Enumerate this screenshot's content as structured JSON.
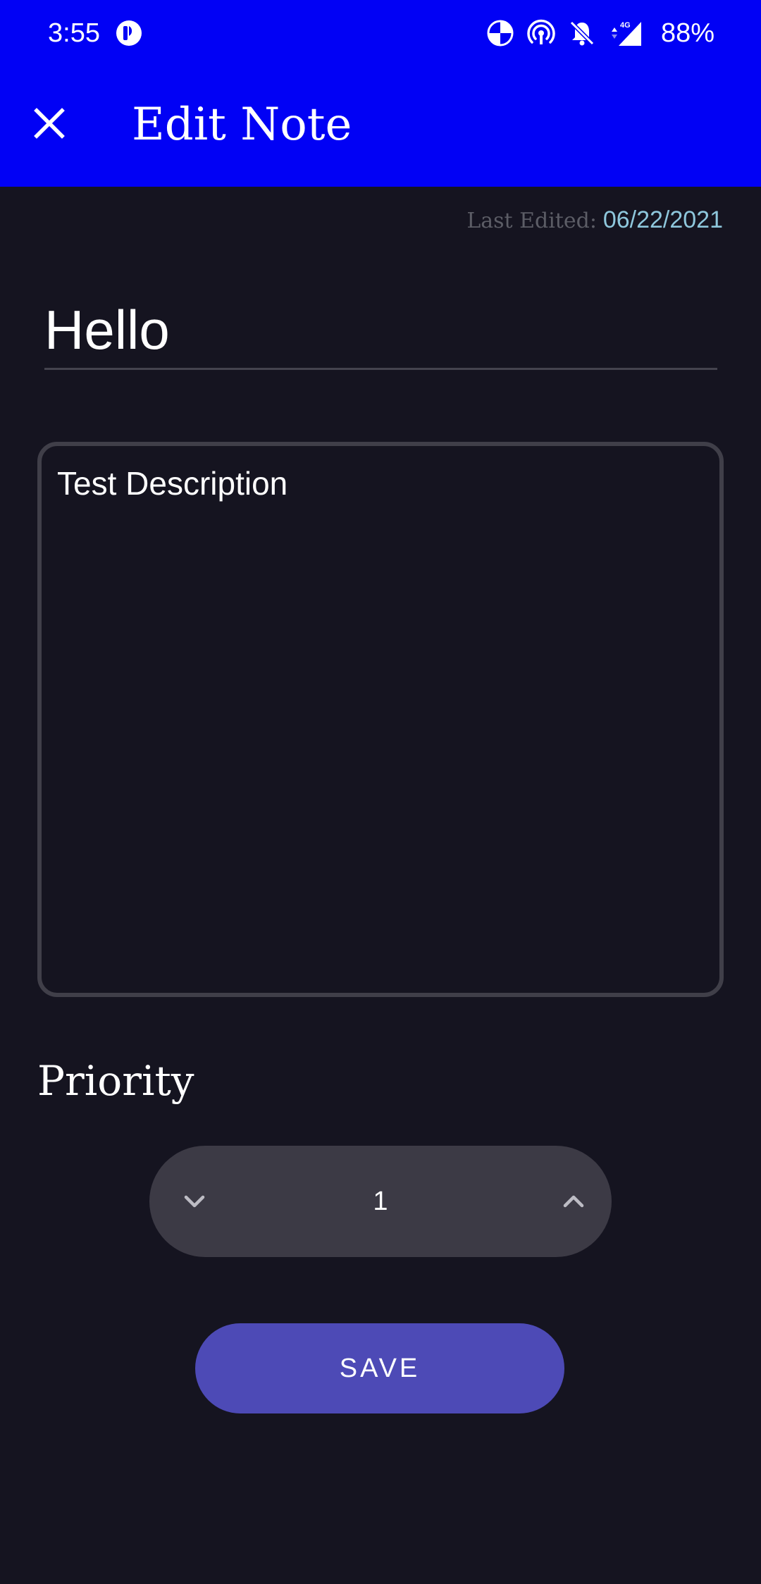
{
  "status_bar": {
    "time": "3:55",
    "battery": "88%",
    "icons": [
      "app-notification-icon",
      "data-saver-icon",
      "hotspot-icon",
      "notifications-off-icon",
      "signal-4g-icon"
    ],
    "network": "4G"
  },
  "toolbar": {
    "title": "Edit Note",
    "close_icon": "close-icon"
  },
  "note": {
    "last_edited_label": "Last Edited:",
    "last_edited_date": "06/22/2021",
    "title": "Hello",
    "description": "Test Description"
  },
  "priority": {
    "label": "Priority",
    "value": "1",
    "decrement_icon": "chevron-down-icon",
    "increment_icon": "chevron-up-icon"
  },
  "actions": {
    "save_label": "SAVE"
  },
  "colors": {
    "app_bar": "#0101f5",
    "background": "#151420",
    "accent_button": "#4d4ab6",
    "stepper_bg": "#3c3a45",
    "date_text": "#8ec7dc",
    "label_text": "#5c5d66"
  }
}
